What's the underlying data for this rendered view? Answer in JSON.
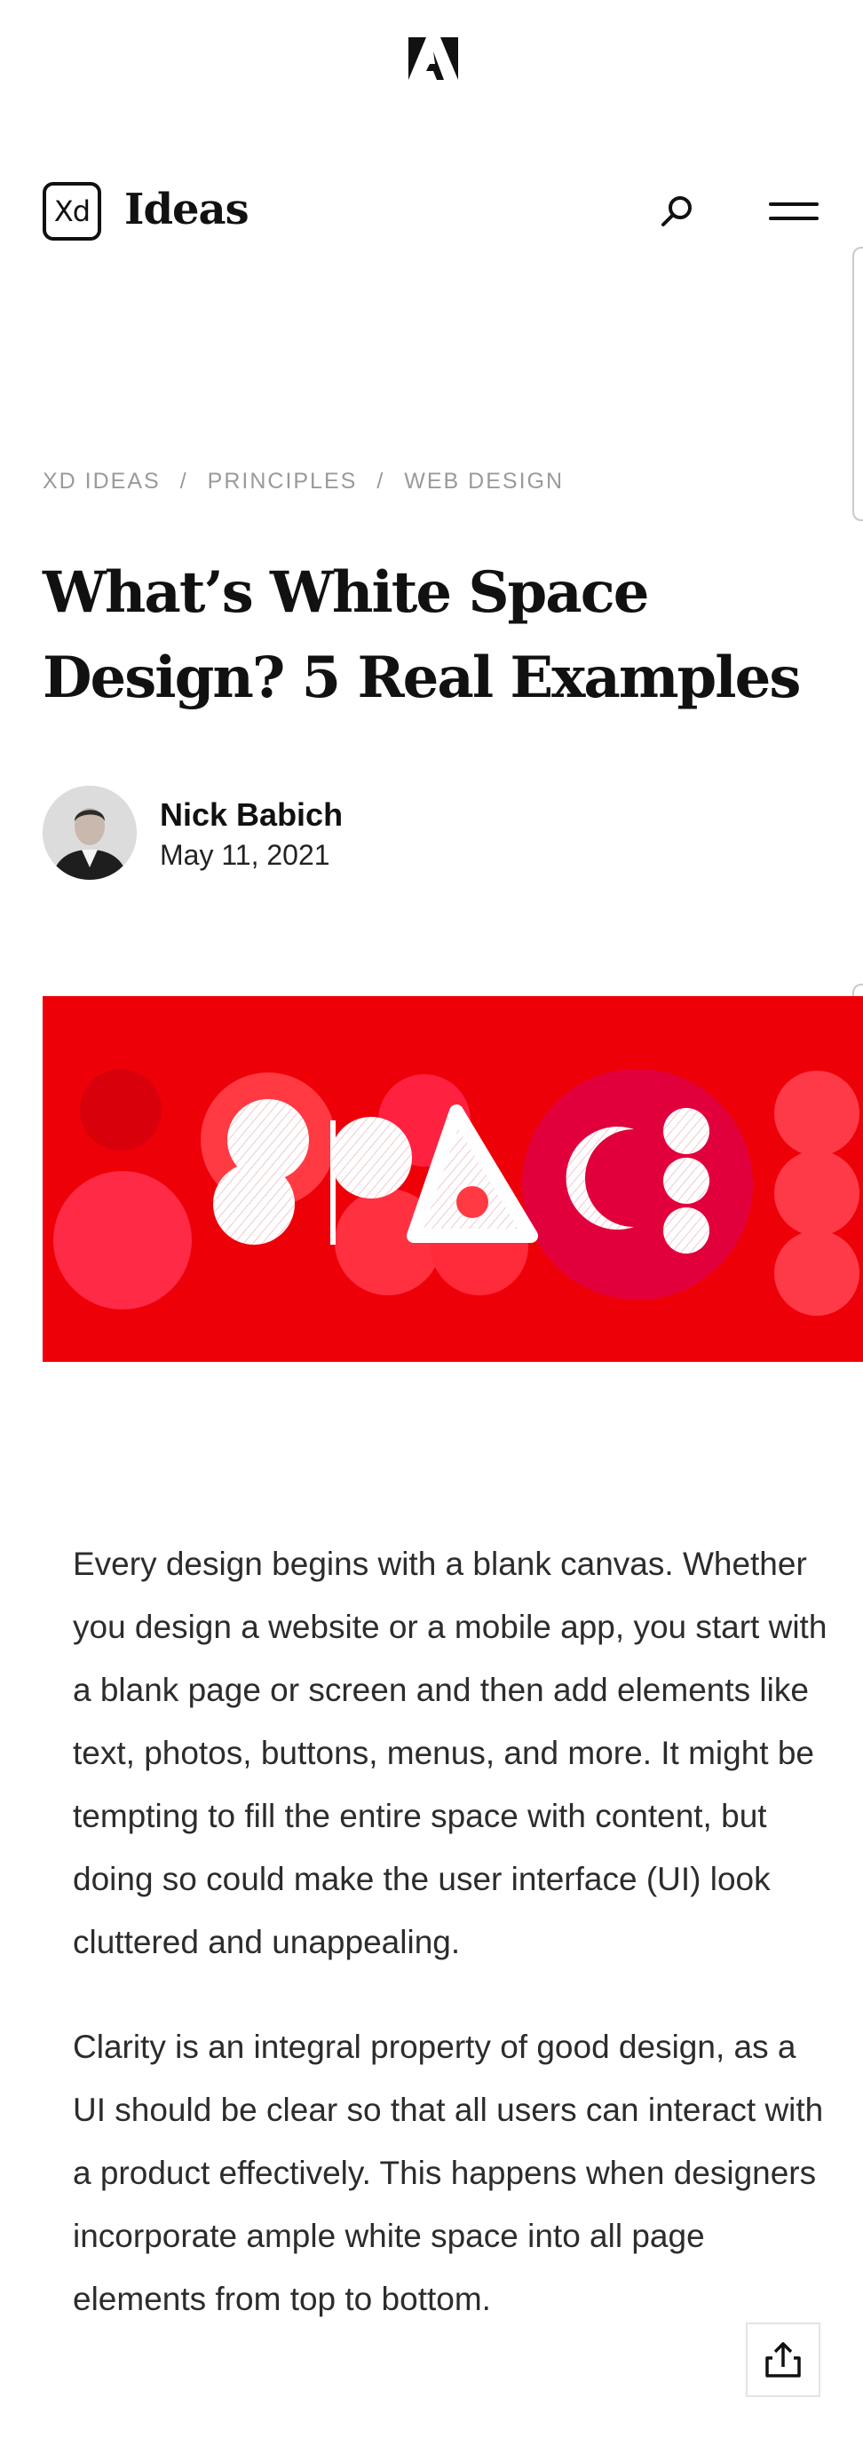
{
  "header": {
    "brand_badge": "Xd",
    "brand_name": "Ideas",
    "icons": {
      "adobe": "adobe-logo-icon",
      "search": "search-icon",
      "menu": "hamburger-menu-icon",
      "share": "share-icon"
    }
  },
  "breadcrumb": {
    "items": [
      "XD IDEAS",
      "PRINCIPLES",
      "WEB DESIGN"
    ],
    "separator": "/"
  },
  "article": {
    "title": "What’s White Space Design? 5 Real Examples",
    "author": "Nick Babich",
    "date": "May 11, 2021",
    "hero_image_text": "SPACE",
    "paragraphs": [
      "Every design begins with a blank canvas. Whether you design a website or a mobile app, you start with a blank page or screen and then add elements like text, photos, buttons, menus, and more. It might be tempting to fill the entire space with content, but doing so could make the user interface (UI) look cluttered and unappealing.",
      "Clarity is an integral property of good design, as a UI should be clear so that all users can interact with a product effectively. This happens when designers incorporate ample white space into all page elements from top to bottom."
    ]
  },
  "colors": {
    "hero_background": "#ee0008",
    "text": "#2c2c2c",
    "muted": "#9a9a9a",
    "heading": "#111111"
  }
}
